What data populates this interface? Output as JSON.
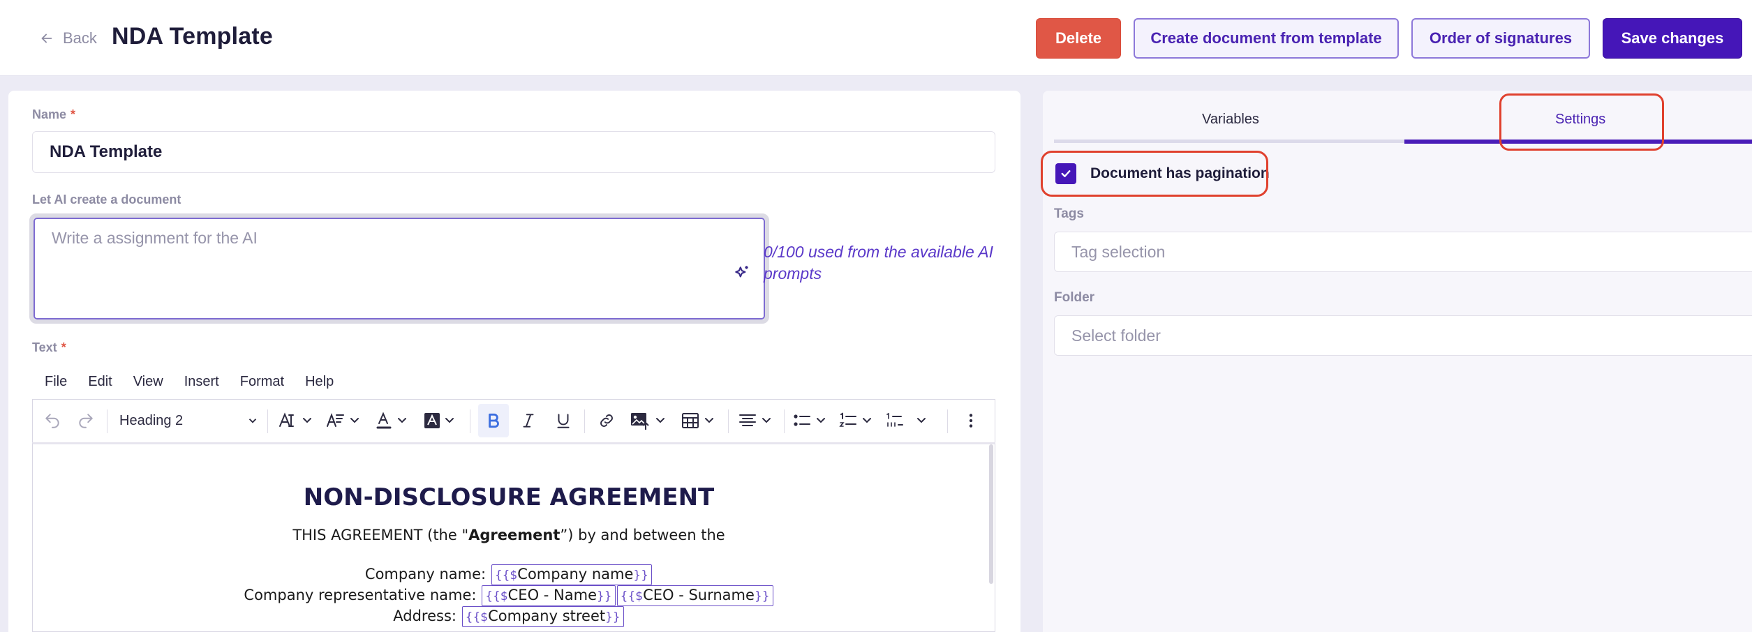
{
  "header": {
    "back_label": "Back",
    "title": "NDA Template",
    "buttons": {
      "delete": "Delete",
      "create": "Create document from template",
      "order": "Order of signatures",
      "save": "Save changes"
    }
  },
  "form": {
    "name_label": "Name",
    "name_value": "NDA Template",
    "required_mark": "*",
    "ai_label": "Let AI create a document",
    "ai_placeholder": "Write a assignment for the AI",
    "ai_usage": "0/100 used from the available AI prompts",
    "text_label": "Text"
  },
  "editor": {
    "menu": [
      "File",
      "Edit",
      "View",
      "Insert",
      "Format",
      "Help"
    ],
    "block_format": "Heading 2",
    "icons": [
      "undo-icon",
      "redo-icon",
      "font-size-icon",
      "line-height-icon",
      "text-color-icon",
      "highlight-color-icon",
      "bold-icon",
      "italic-icon",
      "underline-icon",
      "link-icon",
      "image-icon",
      "table-icon",
      "align-icon",
      "bullet-list-icon",
      "numbered-list-icon",
      "multilevel-list-icon",
      "more-icon"
    ]
  },
  "document": {
    "title": "NON-DISCLOSURE AGREEMENT",
    "intro_before": "THIS AGREEMENT (the \"",
    "intro_bold": "Agreement",
    "intro_after": "”) by and between the",
    "company_label": "Company name:",
    "company_var": "Company name",
    "rep_label": "Company representative name:",
    "rep_var1": "CEO - Name",
    "rep_var2": "CEO - Surname",
    "address_label": "Address:",
    "address_var": "Company street",
    "var_open": "{{$",
    "var_close": "}}"
  },
  "side": {
    "tabs": [
      "Variables",
      "Settings"
    ],
    "active_tab": "Settings",
    "pagination_label": "Document has pagination",
    "pagination_checked": true,
    "tags_label": "Tags",
    "tags_placeholder": "Tag selection",
    "folder_label": "Folder",
    "folder_placeholder": "Select folder"
  },
  "colors": {
    "accent": "#4516b8",
    "danger": "#e05746",
    "highlight": "#e0412e"
  }
}
